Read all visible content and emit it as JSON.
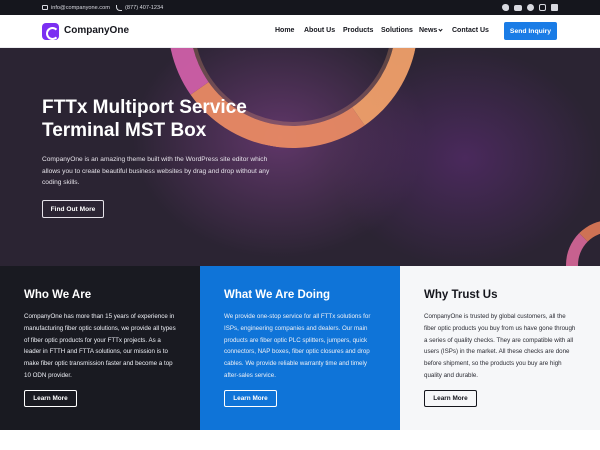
{
  "topbar": {
    "email": "info@companyone.com",
    "phone": "(877) 407-1234",
    "social_icons": [
      "twitter-icon",
      "youtube-icon",
      "facebook-icon",
      "instagram-icon",
      "linkedin-icon"
    ]
  },
  "header": {
    "brand": "CompanyOne",
    "nav": [
      {
        "label": "Home"
      },
      {
        "label": "About Us"
      },
      {
        "label": "Products"
      },
      {
        "label": "Solutions"
      },
      {
        "label": "News"
      },
      {
        "label": "Contact Us"
      }
    ],
    "cta_label": "Send Inquiry"
  },
  "hero": {
    "title": "FTTx Multiport Service Terminal MST Box",
    "description": "CompanyOne is an amazing theme built with the WordPress site editor which allows you to create beautiful business websites by drag and drop without any coding skills.",
    "button_label": "Find Out More"
  },
  "columns": [
    {
      "title": "Who We Are",
      "text": "CompanyOne has more than 15 years of experience in manufacturing fiber optic solutions, we provide all types of fiber optic products for your FTTx projects. As a leader in FTTH and FTTA solutions, our mission is to make fiber optic transmission faster and become a top 10 ODN provider.",
      "button_label": "Learn More"
    },
    {
      "title": "What We Are Doing",
      "text": "We provide one-stop service for all FTTx solutions for ISPs, engineering companies and dealers. Our main products are fiber optic PLC splitters, jumpers, quick connectors, NAP boxes, fiber optic closures and drop cables. We provide reliable warranty time and timely after-sales service.",
      "button_label": "Learn More"
    },
    {
      "title": "Why Trust Us",
      "text": "CompanyOne is trusted by global customers, all the fiber optic products you buy from us have gone through a series of quality checks. They are compatible with all users (ISPs) in the market. All these checks are done before shipment, so the products you buy are high quality and durable.",
      "button_label": "Learn More"
    }
  ],
  "colors": {
    "brand_purple": "#7b2ff2",
    "cta_blue": "#1a7ce6",
    "dark": "#191a21",
    "blue_panel": "#0f74d8"
  }
}
